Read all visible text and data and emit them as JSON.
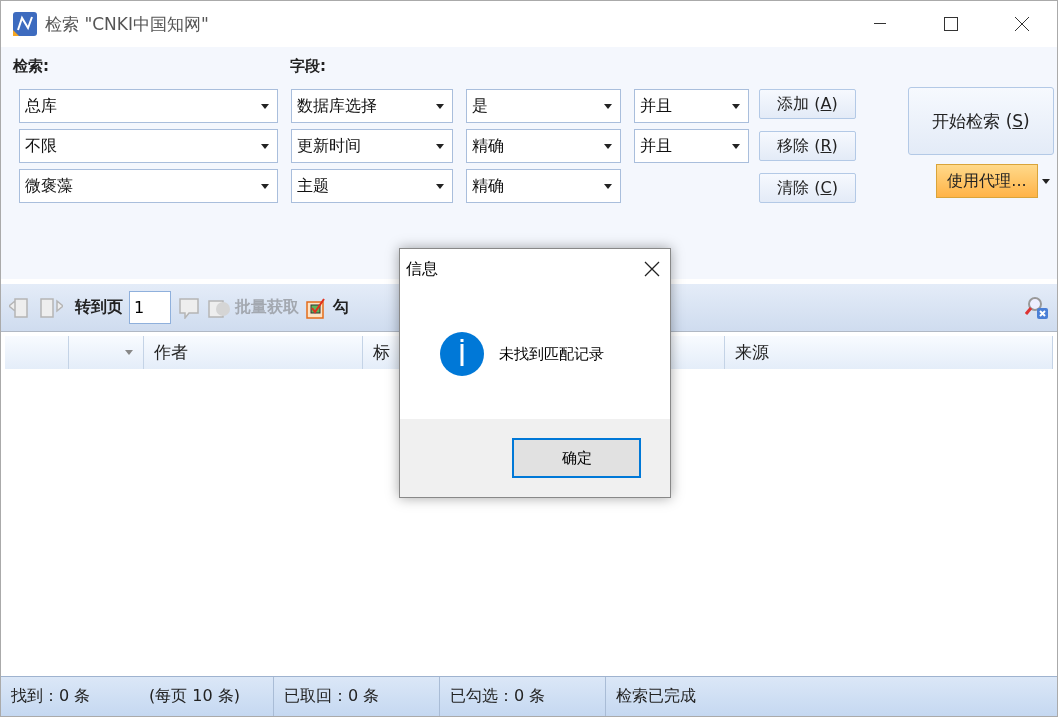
{
  "window": {
    "title": "检索 \"CNKI中国知网\""
  },
  "search_form": {
    "search_label": "检索:",
    "field_label": "字段:",
    "rows": [
      {
        "scope": "总库",
        "field": "数据库选择",
        "match": "是",
        "logic": "并且"
      },
      {
        "scope": "不限",
        "field": "更新时间",
        "match": "精确",
        "logic": "并且"
      },
      {
        "scope": "微褒藻",
        "field": "主题",
        "match": "精确"
      }
    ],
    "buttons": [
      {
        "before": "添加 (",
        "accel": "A",
        "after": ")"
      },
      {
        "before": "移除 (",
        "accel": "R",
        "after": ")"
      },
      {
        "before": "清除 (",
        "accel": "C",
        "after": ")"
      }
    ],
    "start_button": {
      "before": "开始检索 (",
      "accel": "S",
      "after": ")"
    },
    "proxy_button": {
      "label": "使用代理..."
    }
  },
  "toolbar": {
    "goto_label": "转到页",
    "page_value": "1",
    "batch_button": {
      "label": "批量获取",
      "disabled": true
    },
    "check_button": {
      "label": "勾"
    }
  },
  "table": {
    "columns": [
      "作者",
      "标",
      "来源"
    ]
  },
  "dialog": {
    "title": "信息",
    "message": "未找到匹配记录",
    "button": "确定"
  },
  "status_bar": {
    "found": "找到：0 条",
    "per_page": "(每页 10 条)",
    "fetched": "已取回：0 条",
    "checked": "已勾选：0 条",
    "state": "检索已完成"
  }
}
